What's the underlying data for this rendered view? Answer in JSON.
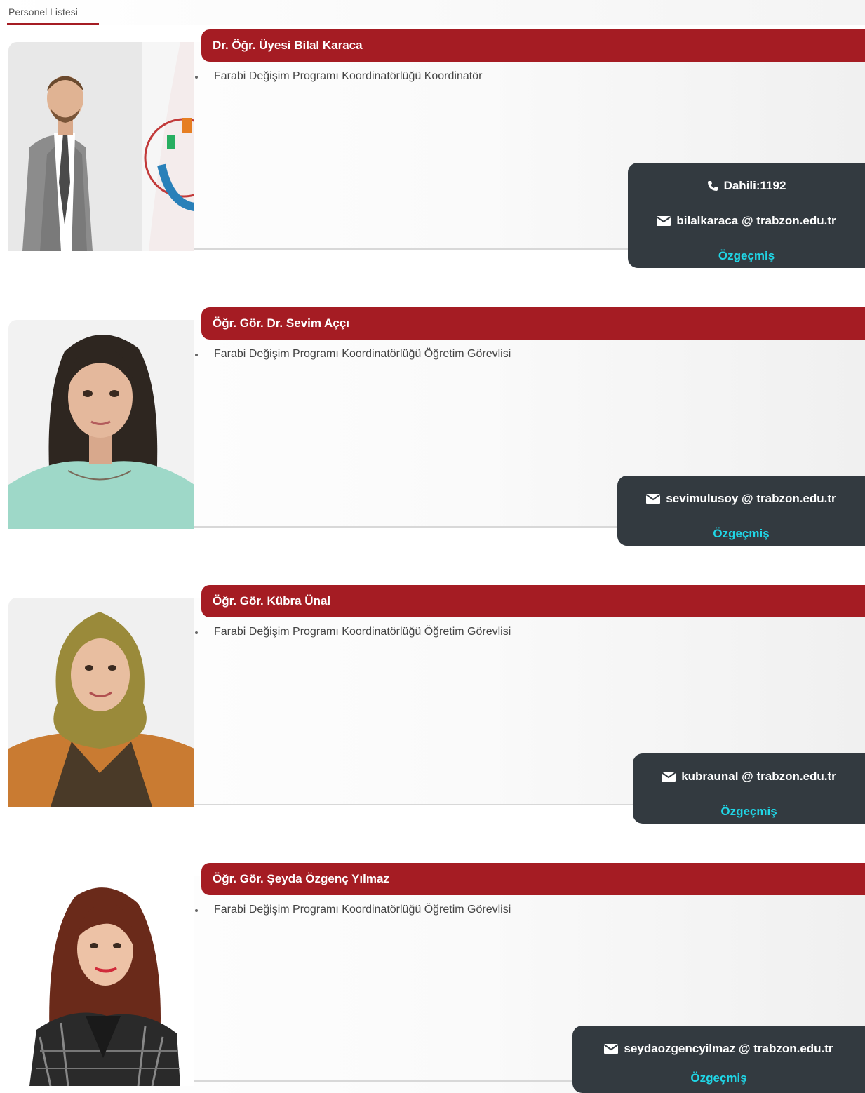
{
  "tab": {
    "label": "Personel Listesi"
  },
  "staff": [
    {
      "name": "Dr. Öğr. Üyesi Bilal Karaca",
      "role": "Farabi Değişim Programı Koordinatörlüğü Koordinatör",
      "phone": "Dahili:1192",
      "email": "bilalkaraca @ trabzon.edu.tr",
      "cv": "Özgeçmiş"
    },
    {
      "name": "Öğr. Gör. Dr. Sevim Aççı",
      "role": "Farabi Değişim Programı Koordinatörlüğü Öğretim Görevlisi",
      "email": "sevimulusoy @ trabzon.edu.tr",
      "cv": "Özgeçmiş"
    },
    {
      "name": "Öğr. Gör. Kübra Ünal",
      "role": "Farabi Değişim Programı Koordinatörlüğü Öğretim Görevlisi",
      "email": "kubraunal @ trabzon.edu.tr",
      "cv": "Özgeçmiş"
    },
    {
      "name": "Öğr. Gör. Şeyda Özgenç Yılmaz",
      "role": "Farabi Değişim Programı Koordinatörlüğü Öğretim Görevlisi",
      "email": "seydaozgencyilmaz @ trabzon.edu.tr",
      "cv": "Özgeçmiş"
    }
  ],
  "colors": {
    "accent": "#a51c23",
    "contact_bg": "#333a40",
    "link": "#20d6e6"
  },
  "icons": {
    "phone": "phone-icon",
    "email": "envelope-icon"
  }
}
